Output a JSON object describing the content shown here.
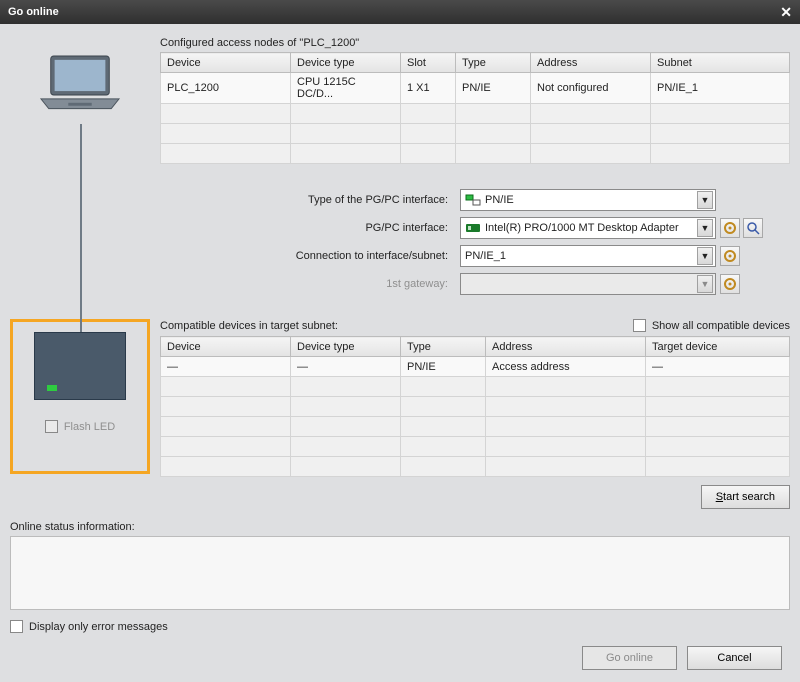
{
  "title": "Go online",
  "configured_label": "Configured access nodes of \"PLC_1200\"",
  "cfg_cols": [
    "Device",
    "Device type",
    "Slot",
    "Type",
    "Address",
    "Subnet"
  ],
  "cfg_rows": [
    {
      "device": "PLC_1200",
      "dtype": "CPU 1215C DC/D...",
      "slot": "1 X1",
      "type": "PN/IE",
      "address": "Not configured",
      "subnet": "PN/IE_1"
    }
  ],
  "settings": {
    "iface_type_label": "Type of the PG/PC interface:",
    "iface_type_value": "PN/IE",
    "iface_label": "PG/PC interface:",
    "iface_value": "Intel(R) PRO/1000 MT Desktop Adapter",
    "conn_label": "Connection to interface/subnet:",
    "conn_value": "PN/IE_1",
    "gateway_label": "1st gateway:",
    "gateway_value": ""
  },
  "flash_led": "Flash LED",
  "compat_label": "Compatible devices in target subnet:",
  "show_all": "Show all compatible devices",
  "compat_cols": [
    "Device",
    "Device type",
    "Type",
    "Address",
    "Target device"
  ],
  "compat_rows": [
    {
      "device": "—",
      "dtype": "—",
      "type": "PN/IE",
      "address": "Access address",
      "target": "—"
    }
  ],
  "start_search": "Start search",
  "status_label": "Online status information:",
  "display_errors": "Display only error messages",
  "go_online": "Go online",
  "cancel": "Cancel"
}
